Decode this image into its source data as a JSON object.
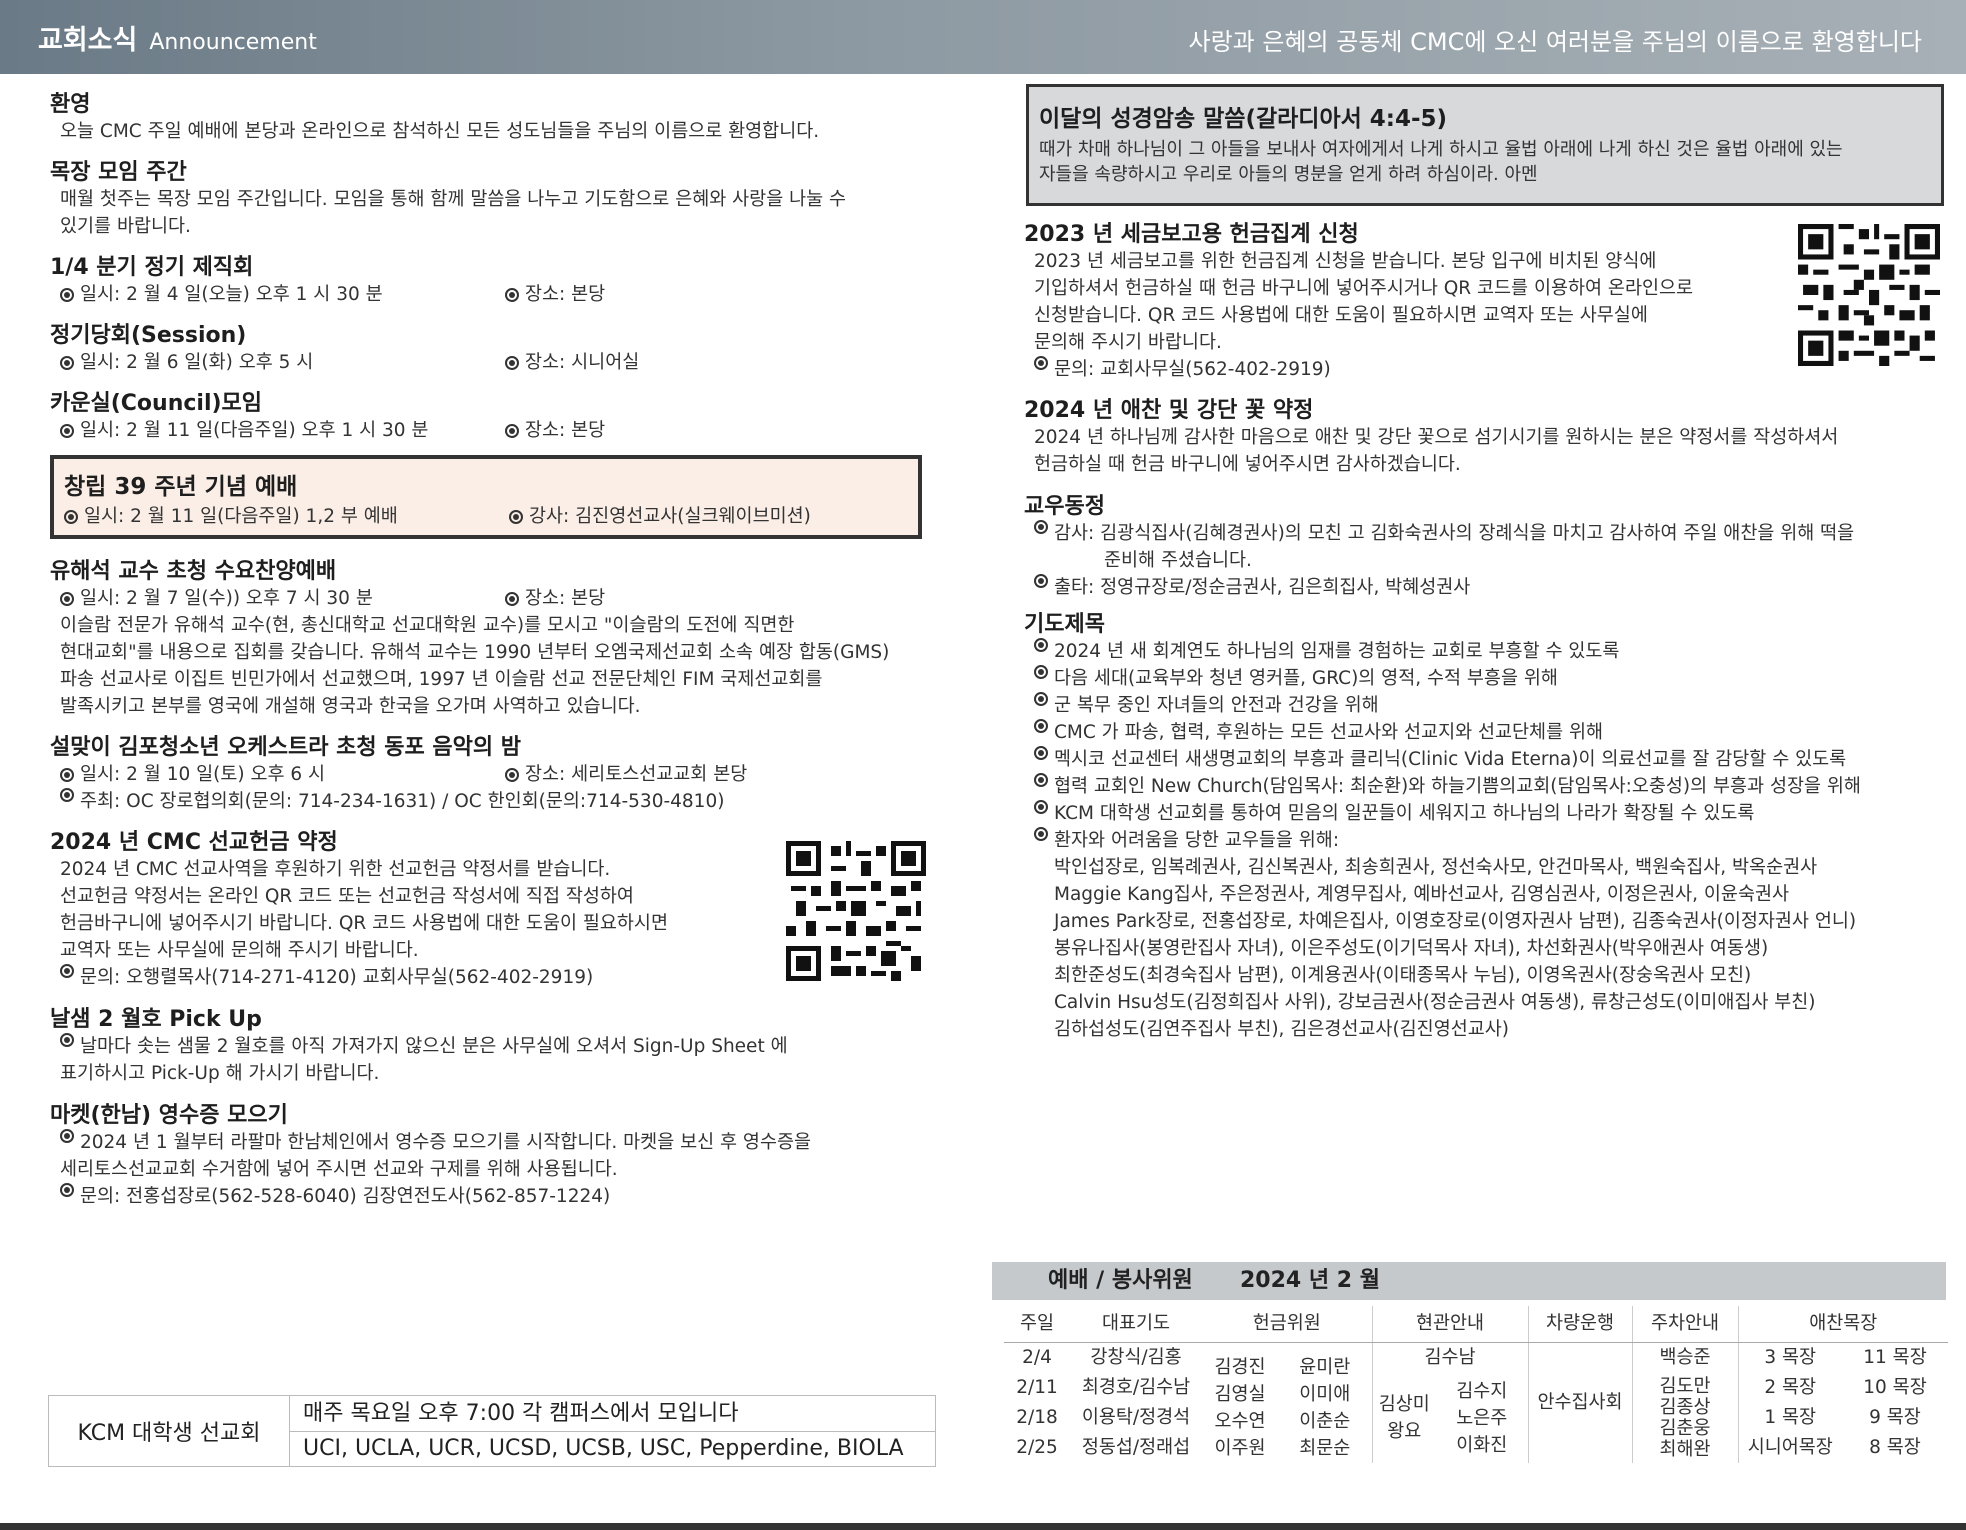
{
  "header": {
    "title_ko": "교회소식",
    "title_en": "Announcement",
    "welcome": "사랑과 은혜의 공동체 CMC에 오신 여러분을 주님의 이름으로 환영합니다"
  },
  "left": {
    "welcome": {
      "title": "환영",
      "text": "오늘 CMC 주일 예배에 본당과 온라인으로 참석하신 모든 성도님들을 주님의 이름으로 환영합니다."
    },
    "mokjang": {
      "title": "목장 모임 주간",
      "line1": "매월 첫주는 목장 모임 주간입니다. 모임을 통해 함께 말씀을 나누고 기도함으로 은혜와 사랑을 나눌 수",
      "line2": "있기를 바랍니다."
    },
    "deacons": {
      "title": "1/4 분기 정기 제직회",
      "when": "일시: 2 월 4 일(오늘) 오후 1 시 30 분",
      "where": "장소: 본당"
    },
    "session": {
      "title": "정기당회(Session)",
      "when": "일시: 2 월 6 일(화) 오후 5 시",
      "where": "장소: 시니어실"
    },
    "council": {
      "title": "카운실(Council)모임",
      "when": "일시: 2 월 11 일(다음주일) 오후 1 시 30 분",
      "where": "장소: 본당"
    },
    "anniversary": {
      "title": "창립 39 주년 기념 예배",
      "when": "일시: 2 월 11 일(다음주일) 1,2 부 예배",
      "speaker": "강사: 김진영선교사(실크웨이브미션)"
    },
    "worship": {
      "title": "유해석 교수 초청 수요찬양예배",
      "when": "일시: 2 월 7 일(수)) 오후 7 시 30 분",
      "where": "장소: 본당",
      "lines": [
        "이슬람 전문가 유해석 교수(현, 총신대학교 선교대학원 교수)를 모시고 \"이슬람의 도전에 직면한",
        "현대교회\"를 내용으로 집회를 갖습니다. 유해석 교수는 1990 년부터 오엠국제선교회 소속 예장 합동(GMS)",
        "파송 선교사로 이집트 빈민가에서 선교했으며, 1997 년 이슬람 선교 전문단체인 FIM 국제선교회를",
        "발족시키고 본부를 영국에 개설해 영국과 한국을 오가며 사역하고 있습니다."
      ]
    },
    "concert": {
      "title": "설맞이 김포청소년 오케스트라 초청 동포 음악의 밤",
      "when": "일시: 2 월 10 일(토) 오후 6 시",
      "where": "장소: 세리토스선교교회 본당",
      "host": "주최: OC 장로협의회(문의: 714-234-1631) / OC 한인회(문의:714-530-4810)"
    },
    "mission": {
      "title": "2024 년 CMC 선교헌금 약정",
      "lines": [
        "2024 년 CMC 선교사역을 후원하기 위한 선교헌금 약정서를 받습니다.",
        "선교헌금 약정서는 온라인 QR 코드 또는 선교헌금 작성서에 직접 작성하여",
        "헌금바구니에 넣어주시기 바랍니다. QR 코드 사용법에 대한 도움이 필요하시면",
        "교역자 또는 사무실에 문의해 주시기 바랍니다."
      ],
      "contact": "문의: 오행렬목사(714-271-4120)  교회사무실(562-402-2919)"
    },
    "pickup": {
      "title": "날샘 2 월호 Pick Up",
      "line1": "날마다 솟는 샘물 2 월호를 아직 가져가지 않으신 분은 사무실에 오셔서 Sign-Up Sheet 에",
      "line2": "표기하시고 Pick-Up 해 가시기 바랍니다."
    },
    "receipt": {
      "title": "마켓(한남) 영수증 모으기",
      "line1": "2024 년 1 월부터 라팔마 한남체인에서 영수증 모으기를 시작합니다. 마켓을 보신 후 영수증을",
      "line2": "세리토스선교교회 수거함에 넣어 주시면 선교와 구제를 위해 사용됩니다.",
      "contact": "문의: 전홍섭장로(562-528-6040)  김장연전도사(562-857-1224)"
    },
    "kcm": {
      "name": "KCM 대학생 선교회",
      "time": "매주 목요일 오후 7:00 각 캠퍼스에서 모입니다",
      "campuses": "UCI, UCLA, UCR, UCSD, UCSB, USC, Pepperdine, BIOLA"
    }
  },
  "right": {
    "verse": {
      "title": "이달의 성경암송 말씀(갈라디아서 4:4-5)",
      "line1": "때가 차매 하나님이 그 아들을 보내사 여자에게서 나게 하시고 율법 아래에 나게 하신 것은 율법 아래에 있는",
      "line2": "자들을 속량하시고 우리로 아들의 명분을 얻게 하려 하심이라. 아멘"
    },
    "tax": {
      "title": "2023 년 세금보고용 헌금집계 신청",
      "lines": [
        "2023 년 세금보고를 위한 헌금집계 신청을 받습니다. 본당 입구에 비치된 양식에",
        "기입하셔서 헌금하실 때 헌금 바구니에 넣어주시거나 QR 코드를 이용하여 온라인으로",
        "신청받습니다. QR 코드 사용법에 대한 도움이 필요하시면  교역자 또는 사무실에",
        "문의해 주시기 바랍니다."
      ],
      "contact": "문의: 교회사무실(562-402-2919)"
    },
    "flowers": {
      "title": "2024 년 애찬 및 강단 꽃 약정",
      "line1": "2024 년 하나님께 감사한 마음으로 애찬 및 강단 꽃으로 섬기시기를 원하시는 분은 약정서를 작성하셔서",
      "line2": "헌금하실 때 헌금 바구니에 넣어주시면 감사하겠습니다."
    },
    "news": {
      "title": "교우동정",
      "thanks1": "감사: 김광식집사(김혜경권사)의 모친 고 김화숙권사의 장례식을 마치고 감사하여 주일 애찬을 위해 떡을",
      "thanks2": "준비해 주셨습니다.",
      "birth": "출타: 정영규장로/정순금권사, 김은희집사, 박혜성권사"
    },
    "prayer": {
      "title": "기도제목",
      "items": [
        "2024 년 새 회계연도 하나님의 임재를 경험하는 교회로 부흥할 수 있도록",
        "다음 세대(교육부와 청년 영커플, GRC)의 영적, 수적 부흥을 위해",
        "군 복무 중인 자녀들의 안전과 건강을 위해",
        "CMC 가 파송, 협력, 후원하는 모든 선교사와 선교지와 선교단체를 위해",
        "멕시코 선교센터 새생명교회의 부흥과 클리닉(Clinic Vida Eterna)이 의료선교를 잘 감당할 수 있도록",
        "협력 교회인 New Church(담임목사: 최순환)와 하늘기쁨의교회(담임목사:오충성)의 부흥과 성장을 위해",
        "KCM 대학생 선교회를 통하여 믿음의 일꾼들이 세워지고 하나님의 나라가 확장될 수 있도록",
        "환자와 어려움을 당한 교우들을 위해:"
      ],
      "patients": [
        "박인섭장로, 임복례권사, 김신복권사, 최송희권사, 정선숙사모, 안건마목사, 백원숙집사, 박옥순권사",
        "Maggie Kang집사, 주은정권사, 계영무집사, 예바선교사, 김영심권사, 이정은권사, 이윤숙권사",
        "James Park장로, 전홍섭장로, 차예은집사, 이영호장로(이영자권사 남편), 김종숙권사(이정자권사 언니)",
        "봉유나집사(봉영란집사 자녀), 이은주성도(이기덕목사 자녀), 차선화권사(박우애권사 여동생)",
        "최한준성도(최경숙집사 남편), 이계용권사(이태종목사 누님), 이영옥권사(장숭옥권사 모친)",
        "Calvin Hsu성도(김정희집사 사위), 강보금권사(정순금권사 여동생), 류창근성도(이미애집사 부친)",
        "김하섭성도(김연주집사 부친), 김은경선교사(김진영선교사)"
      ]
    },
    "service": {
      "title": "예배 / 봉사위원",
      "month": "2024 년 2 월",
      "headers": [
        "주일",
        "대표기도",
        "헌금위원",
        "현관안내",
        "차량운행",
        "주차안내",
        "애찬목장"
      ],
      "dates": [
        "2/4",
        "2/11",
        "2/18",
        "2/25"
      ],
      "prayer": [
        "강창식/김홍",
        "최경호/김수남",
        "이용탁/정경석",
        "정동섭/정래섭"
      ],
      "offering_a": [
        "김경진",
        "김영실",
        "오수연",
        "이주원"
      ],
      "offering_b": [
        "윤미란",
        "이미애",
        "이춘순",
        "최문순"
      ],
      "door_top": "김수남",
      "door_a": [
        "김상미",
        "왕요"
      ],
      "door_b": [
        "김수지",
        "노은주",
        "이화진"
      ],
      "vehicle": "안수집사회",
      "parking": [
        "백승준",
        "김도만",
        "김종상",
        "김춘웅",
        "최해완"
      ],
      "meal_a": [
        "3 목장",
        "2 목장",
        "1 목장",
        "시니어목장"
      ],
      "meal_b": [
        "11 목장",
        "10 목장",
        "9 목장",
        "8 목장"
      ]
    }
  }
}
